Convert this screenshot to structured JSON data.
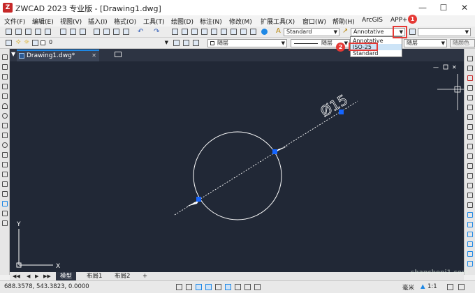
{
  "window": {
    "title": "ZWCAD 2023 专业版 - [Drawing1.dwg]",
    "logo": "Z"
  },
  "menu": [
    "文件(F)",
    "编辑(E)",
    "视图(V)",
    "插入(I)",
    "格式(O)",
    "工具(T)",
    "绘图(D)",
    "标注(N)",
    "修改(M)",
    "扩展工具(X)",
    "窗口(W)",
    "帮助(H)",
    "ArcGIS",
    "APP+"
  ],
  "toolbar": {
    "text_style": "Standard",
    "dim_style": "Annotative",
    "layer_value": "0",
    "color_value": "随层",
    "linetype_value": "随层",
    "lineweight_value": "随层",
    "plotstyle_value": "随颜色"
  },
  "dim_style_dropdown": {
    "options": [
      "Annotative",
      "ISO-25",
      "Standard"
    ],
    "highlighted": "ISO-25"
  },
  "badges": {
    "one": "1",
    "two": "2"
  },
  "document_tab": "Drawing1.dwg*",
  "drawing": {
    "dimension_text": "Ø15"
  },
  "axes": {
    "x": "X",
    "y": "Y"
  },
  "layout_tabs": [
    "模型",
    "布局1",
    "布局2",
    "+"
  ],
  "status": {
    "coords": "688.3578, 543.3823, 0.0000",
    "units": "毫米",
    "scale": "1:1"
  },
  "watermark": "shancheni1.com",
  "colors": {
    "canvas": "#212836",
    "accent": "#1e88e5",
    "marker": "#e53935",
    "grip": "#1565ff"
  }
}
